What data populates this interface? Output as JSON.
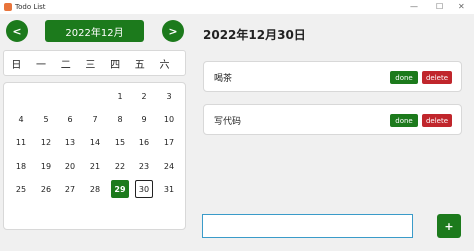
{
  "window": {
    "title": "Todo List",
    "minimize": "—",
    "maximize": "☐",
    "close": "✕"
  },
  "calendar": {
    "prev_label": "<",
    "next_label": ">",
    "month_label": "2022年12月",
    "weekdays": [
      "日",
      "一",
      "二",
      "三",
      "四",
      "五",
      "六"
    ],
    "today": "29",
    "selected": "30",
    "weeks": [
      [
        "",
        "",
        "",
        "",
        "1",
        "2",
        "3"
      ],
      [
        "4",
        "5",
        "6",
        "7",
        "8",
        "9",
        "10"
      ],
      [
        "11",
        "12",
        "13",
        "14",
        "15",
        "16",
        "17"
      ],
      [
        "18",
        "19",
        "20",
        "21",
        "22",
        "23",
        "24"
      ],
      [
        "25",
        "26",
        "27",
        "28",
        "29",
        "30",
        "31"
      ]
    ]
  },
  "selected_date": "2022年12月30日",
  "todos": [
    {
      "text": "喝茶",
      "done_label": "done",
      "delete_label": "delete"
    },
    {
      "text": "写代码",
      "done_label": "done",
      "delete_label": "delete"
    }
  ],
  "new_todo": {
    "value": "",
    "add_label": "+"
  },
  "colors": {
    "primary": "#1c7a1c",
    "danger": "#c0262c",
    "input_border": "#3a9bc9"
  }
}
